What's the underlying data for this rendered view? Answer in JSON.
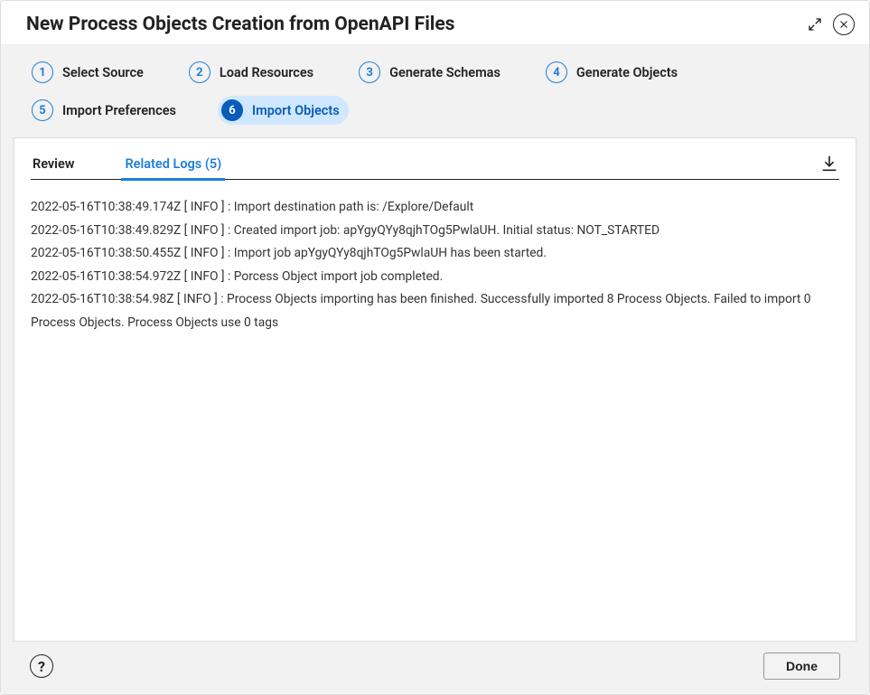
{
  "dialog": {
    "title": "New Process Objects Creation from OpenAPI Files"
  },
  "steps": [
    {
      "num": "1",
      "label": "Select Source"
    },
    {
      "num": "2",
      "label": "Load Resources"
    },
    {
      "num": "3",
      "label": "Generate Schemas"
    },
    {
      "num": "4",
      "label": "Generate Objects"
    },
    {
      "num": "5",
      "label": "Import Preferences"
    },
    {
      "num": "6",
      "label": "Import Objects"
    }
  ],
  "active_step_index": 5,
  "tabs": {
    "review": "Review",
    "related_logs": "Related Logs (5)"
  },
  "active_tab": "related_logs",
  "logs": [
    "2022-05-16T10:38:49.174Z  [ INFO ] :  Import destination path is: /Explore/Default",
    "2022-05-16T10:38:49.829Z  [ INFO ] :  Created import job: apYgyQYy8qjhTOg5PwlaUH. Initial status: NOT_STARTED",
    "2022-05-16T10:38:50.455Z  [ INFO ] :  Import job apYgyQYy8qjhTOg5PwlaUH has been started.",
    "2022-05-16T10:38:54.972Z  [ INFO ] :  Porcess Object import job completed.",
    "2022-05-16T10:38:54.98Z  [ INFO ] :  Process Objects importing has been finished. Successfully imported 8 Process Objects. Failed to import 0 Process Objects. Process Objects use 0 tags"
  ],
  "footer": {
    "help": "?",
    "done": "Done"
  }
}
